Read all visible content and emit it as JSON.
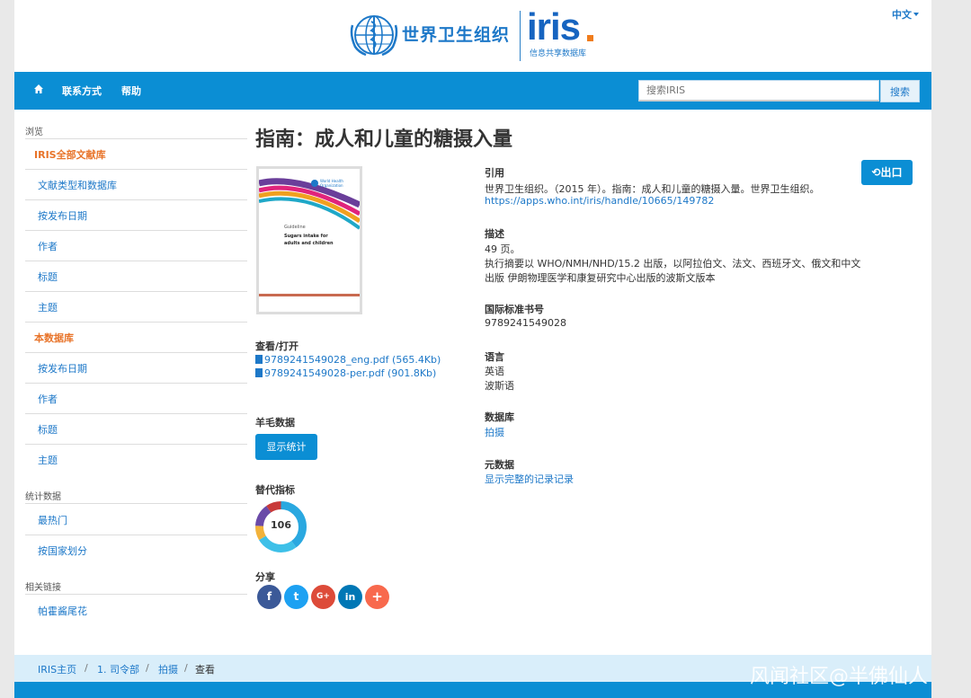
{
  "header": {
    "who_name": "世界卫生组织",
    "iris_title": "iris",
    "iris_subtitle": "信息共享数据库",
    "language": "中文"
  },
  "navbar": {
    "home_icon": "home-icon",
    "links": [
      "联系方式",
      "帮助"
    ],
    "search_placeholder": "搜索IRIS",
    "search_button": "搜索"
  },
  "sidebar": {
    "browse_heading": "浏览",
    "items_all": [
      "IRIS全部文献库",
      "文献类型和数据库",
      "按发布日期",
      "作者",
      "标题",
      "主题"
    ],
    "items_this": [
      "本数据库",
      "按发布日期",
      "作者",
      "标题",
      "主题"
    ],
    "stats_heading": "统计数据",
    "stats_items": [
      "最热门",
      "按国家划分"
    ],
    "links_heading": "相关链接",
    "links_items": [
      "帕霍酱尾花"
    ]
  },
  "item": {
    "title": "指南：成人和儿童的糖摄入量",
    "thumbnail_text_1": "Guideline",
    "thumbnail_text_2": "Sugars intake for",
    "thumbnail_text_3": "adults and children",
    "thumbnail_logo_text": "World Health Organization",
    "export_label": "出口",
    "view_open_label": "查看/打开",
    "files": [
      "9789241549028_eng.pdf (565.4Kb)",
      "9789241549028-per.pdf (901.8Kb)"
    ],
    "wool_data_label": "羊毛数据",
    "show_stats_button": "显示统计",
    "altmetric_label": "替代指标",
    "altmetric_score": "106",
    "share_label": "分享",
    "share_buttons": [
      "f",
      "t",
      "G+",
      "in",
      "+"
    ],
    "citation_label": "引用",
    "citation_text": "世界卫生组织。（2015 年）。指南：成人和儿童的糖摄入量。世界卫生组织。",
    "citation_link": "https://apps.who.int/iris/handle/10665/149782",
    "description_label": "描述",
    "description_pages": "49 页。",
    "description_line1": "执行摘要以 WHO/NMH/NHD/15.2 出版，以阿拉伯文、法文、西班牙文、俄文和中文",
    "description_line2": "出版 伊朗物理医学和康复研究中心出版的波斯文版本",
    "isbn_label": "国际标准书号",
    "isbn": "9789241549028",
    "language_label": "语言",
    "languages": [
      "英语",
      "波斯语"
    ],
    "database_label": "数据库",
    "database_value": "拍摄",
    "metadata_label": "元数据",
    "metadata_link": "显示完整的记录记录"
  },
  "breadcrumb": [
    "IRIS主页",
    "1. 司令部",
    "拍摄",
    "查看"
  ],
  "watermark": "风闻社区@半佛仙人",
  "colors": {
    "primary": "#0b8ed4",
    "link": "#1d78c8",
    "highlight": "#e8742a",
    "facebook": "#3b5998",
    "twitter": "#1da1f2",
    "googleplus": "#dd4b39",
    "linkedin": "#0077b5",
    "addthis": "#f8694d"
  }
}
